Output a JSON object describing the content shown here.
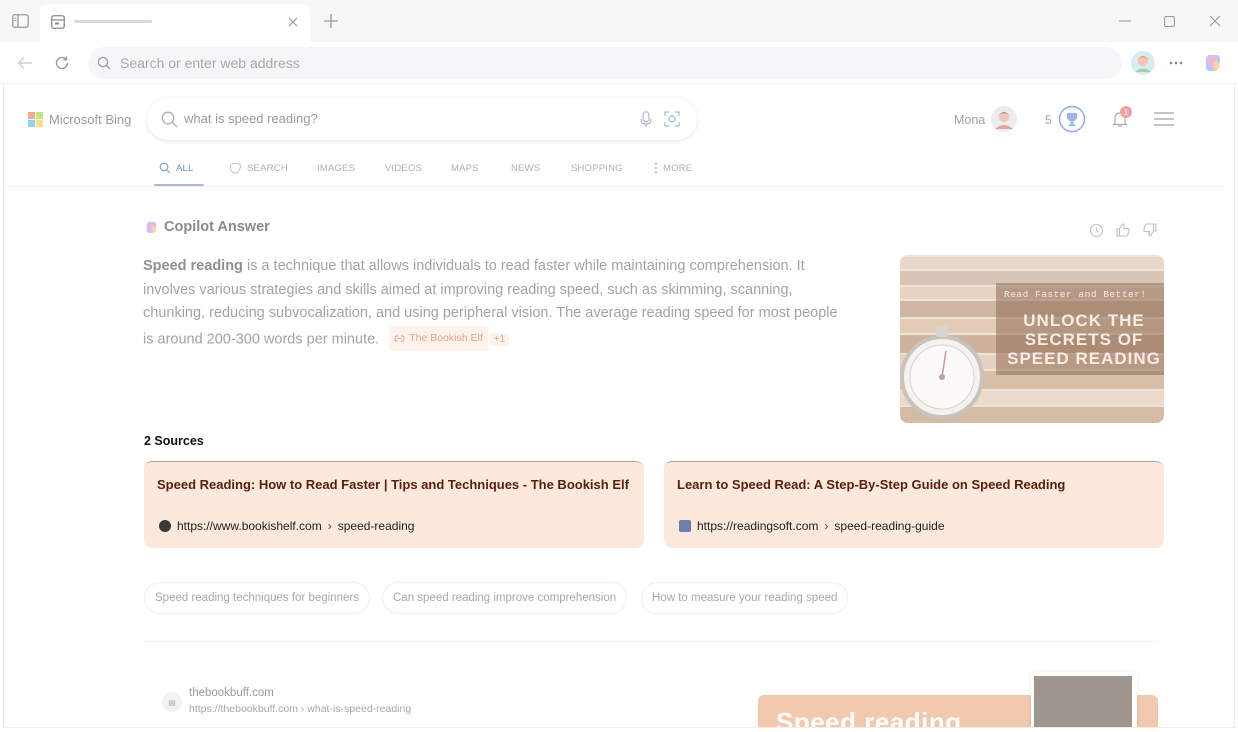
{
  "browser": {
    "address_placeholder": "Search or enter web address"
  },
  "bing": {
    "logo_text": "Microsoft Bing",
    "query": "what is speed reading?",
    "user_name": "Mona",
    "rewards_points": "5",
    "notifications_count": "1",
    "nav_tabs": [
      {
        "label": "ALL",
        "active": true
      },
      {
        "label": "SEARCH",
        "active": false
      },
      {
        "label": "IMAGES",
        "active": false
      },
      {
        "label": "VIDEOS",
        "active": false
      },
      {
        "label": "MAPS",
        "active": false
      },
      {
        "label": "NEWS",
        "active": false
      },
      {
        "label": "SHOPPING",
        "active": false
      },
      {
        "label": "MORE",
        "active": false
      }
    ]
  },
  "copilot": {
    "title": "Copilot Answer",
    "answer_bold": "Speed reading",
    "answer_rest": " is a technique that allows individuals to read faster while maintaining comprehension. It involves various strategies and skills aimed at improving reading speed, such as skimming, scanning, chunking, reducing subvocalization, and using peripheral vision. The average reading speed for most people is around 200-300 words per minute.",
    "citation": "The Bookish Elf",
    "citation_more": "+1",
    "image_tagline": "Read Faster and Better!",
    "image_headline_1": "UNLOCK THE",
    "image_headline_2": "SECRETS OF",
    "image_headline_3": "SPEED READING"
  },
  "sources": {
    "label": "2 Sources",
    "items": [
      {
        "title": "Speed Reading: How to Read Faster | Tips and Techniques - The Bookish Elf",
        "url": "https://www.bookishelf.com",
        "path": "speed-reading"
      },
      {
        "title": "Learn to Speed Read: A Step-By-Step Guide on Speed Reading",
        "url": "https://readingsoft.com",
        "path": "speed-reading-guide"
      }
    ]
  },
  "suggestions": [
    "Speed reading techniques for beginners",
    "Can speed reading improve comprehension",
    "How to measure your reading speed"
  ],
  "result": {
    "site": "thebookbuff.com",
    "url": "https://thebookbuff.com › what-is-speed-reading",
    "thumb_text": "Speed reading"
  },
  "colors": {
    "ms_red": "#f25022",
    "ms_green": "#7fba00",
    "ms_blue": "#00a4ef",
    "ms_yellow": "#ffb900",
    "source_card_bg": "#fde9dc",
    "source_title": "#5a1e0c",
    "notification_badge": "#f08a8a",
    "rewards_ring": "#3b6fd8"
  }
}
